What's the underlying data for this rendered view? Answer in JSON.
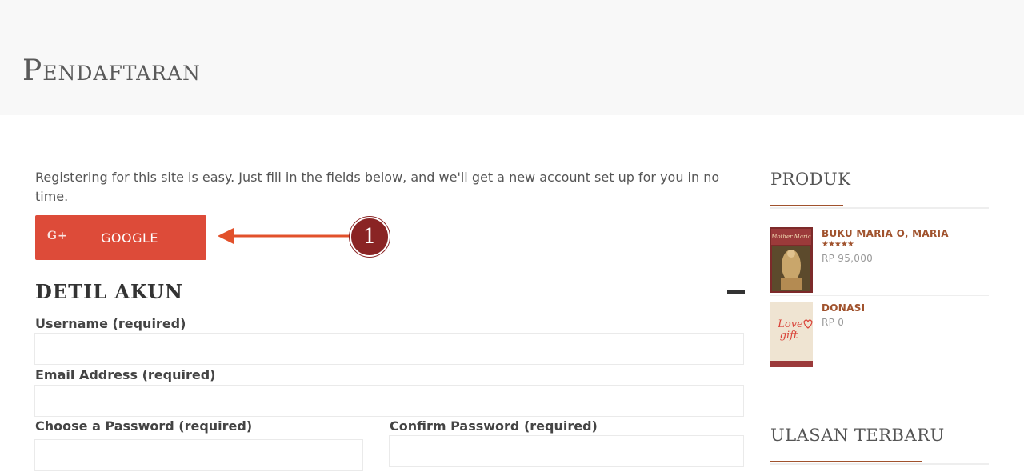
{
  "header": {
    "title": "Pendaftaran"
  },
  "intro": "Registering for this site is easy. Just fill in the fields below, and we'll get a new account set up for you in no time.",
  "social_login": {
    "google_icon": "G+",
    "google_label": "GOOGLE"
  },
  "annotation": {
    "step_number": "1"
  },
  "account_section": {
    "title": "DETIL AKUN"
  },
  "fields": {
    "username": {
      "label": "Username (required)",
      "value": ""
    },
    "email": {
      "label": "Email Address (required)",
      "value": ""
    },
    "password": {
      "label": "Choose a Password (required)",
      "value": ""
    },
    "confirm_password": {
      "label": "Confirm Password (required)",
      "value": ""
    }
  },
  "sidebar": {
    "products_heading": "PRODUK",
    "products": [
      {
        "name": "BUKU MARIA O, MARIA",
        "price": "RP 95,000",
        "rating": 5,
        "stars": "★★★★★",
        "thumb_text": "Mother Maria"
      },
      {
        "name": "DONASI",
        "price": "RP 0",
        "thumb_text_1": "Love",
        "thumb_text_2": "gift"
      }
    ],
    "reviews_heading": "ULASAN TERBARU"
  },
  "colors": {
    "accent": "#a0522d",
    "google": "#dd4b39",
    "badge": "#8a2424",
    "arrow": "#e2512b"
  }
}
